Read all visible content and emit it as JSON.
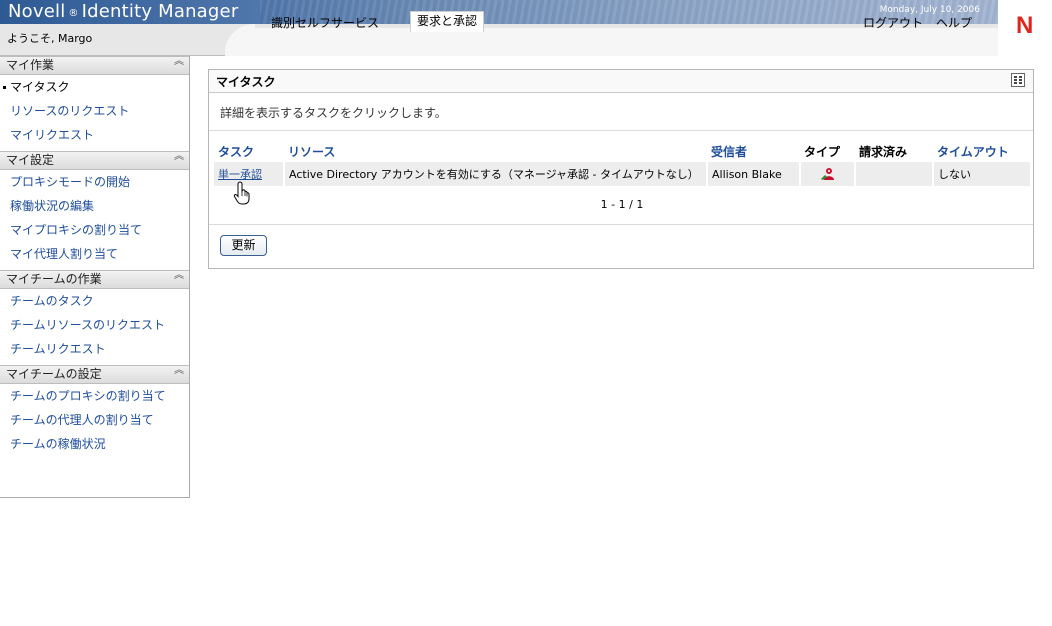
{
  "header": {
    "product_title": "Novell",
    "product_reg": "®",
    "product_title_rest": "Identity Manager",
    "date": "Monday, July 10, 2006",
    "logo_letter": "N",
    "welcome": "ようこそ, Margo",
    "tabs": [
      {
        "label": "識別セルフサービス",
        "active": false
      },
      {
        "label": "要求と承認",
        "active": true
      }
    ],
    "logout_label": "ログアウト",
    "help_label": "ヘルプ"
  },
  "sidebar": {
    "groups": [
      {
        "title": "マイ作業",
        "items": [
          {
            "label": "マイタスク",
            "active": true
          },
          {
            "label": "リソースのリクエスト",
            "active": false
          },
          {
            "label": "マイリクエスト",
            "active": false
          }
        ]
      },
      {
        "title": "マイ設定",
        "items": [
          {
            "label": "プロキシモードの開始"
          },
          {
            "label": "稼働状況の編集"
          },
          {
            "label": "マイプロキシの割り当て"
          },
          {
            "label": "マイ代理人割り当て"
          }
        ]
      },
      {
        "title": "マイチームの作業",
        "items": [
          {
            "label": "チームのタスク"
          },
          {
            "label": "チームリソースのリクエスト"
          },
          {
            "label": "チームリクエスト"
          }
        ]
      },
      {
        "title": "マイチームの設定",
        "items": [
          {
            "label": "チームのプロキシの割り当て"
          },
          {
            "label": "チームの代理人の割り当て"
          },
          {
            "label": "チームの稼働状況"
          }
        ]
      }
    ]
  },
  "main": {
    "panel_title": "マイタスク",
    "instruction": "詳細を表示するタスクをクリックします。",
    "columns": {
      "task": "タスク",
      "resource": "リソース",
      "recipient": "受信者",
      "type": "タイプ",
      "claimed": "請求済み",
      "timeout": "タイムアウト"
    },
    "rows": [
      {
        "task": "単一承認",
        "resource": "Active Directory アカウントを有効にする（マネージャ承認 - タイムアウトなし）",
        "recipient": "Allison Blake",
        "type_icon": "user-role-icon",
        "claimed": "",
        "timeout": "しない"
      }
    ],
    "pager": "1 - 1 / 1",
    "refresh_label": "更新"
  }
}
